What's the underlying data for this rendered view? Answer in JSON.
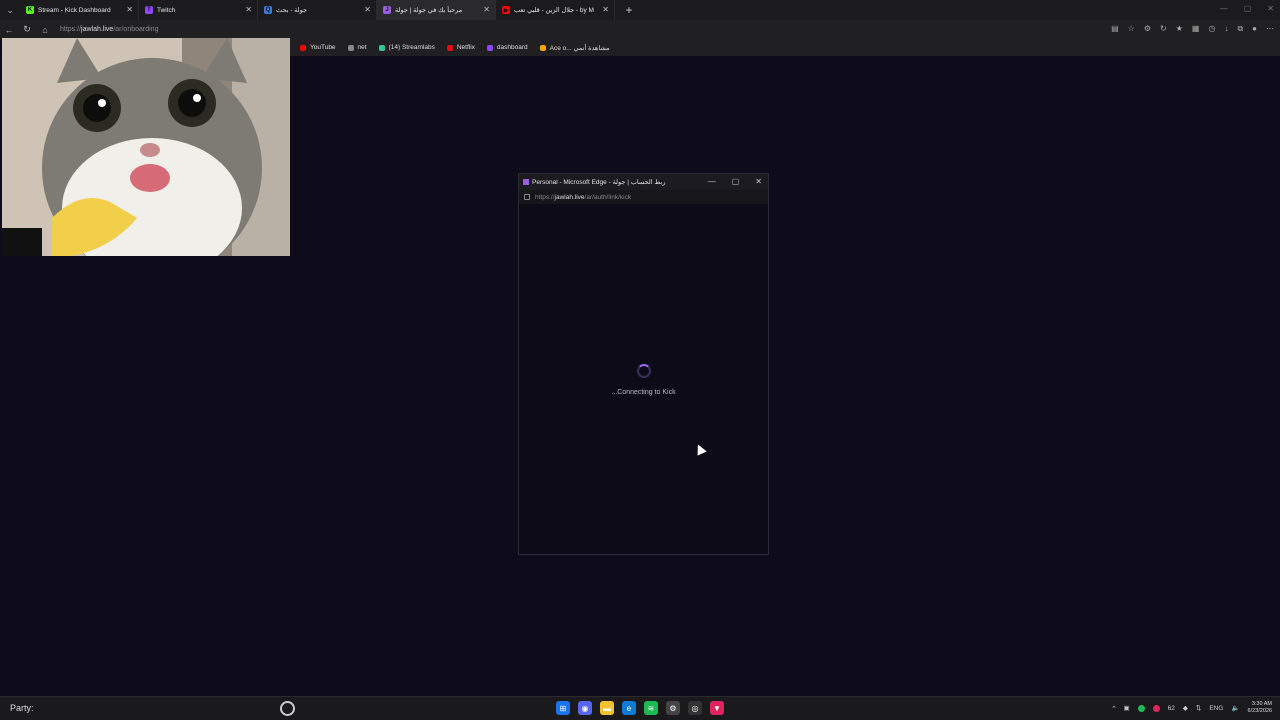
{
  "tabs": [
    {
      "title": "Stream - Kick Dashboard",
      "icon": "kick-icon",
      "color": "#53fc18",
      "glyph": "K"
    },
    {
      "title": "Twitch",
      "icon": "twitch-icon",
      "color": "#9146ff",
      "glyph": "T"
    },
    {
      "title": "جولة - بحث",
      "icon": "search-icon",
      "color": "#3a7bd5",
      "glyph": "Q"
    },
    {
      "title": "مرحباً بك في جولة | جولة",
      "icon": "jawlah-icon",
      "color": "#9b5de5",
      "glyph": "J",
      "active": true
    },
    {
      "title": "جلال الزين - قلبي تعب - by M",
      "icon": "youtube-icon",
      "color": "#ff0000",
      "glyph": "▶"
    }
  ],
  "address_bar": {
    "prefix": "https://",
    "domain": "jawlah.live",
    "path": "/ar/onboarding"
  },
  "bookmarks": [
    {
      "label": "YouTube",
      "color": "#ff0000"
    },
    {
      "label": "net",
      "color": "#888888"
    },
    {
      "label": "(14) Streamlabs",
      "color": "#31c3a2"
    },
    {
      "label": "Netflix",
      "color": "#e50914"
    },
    {
      "label": "dashboard",
      "color": "#9146ff"
    },
    {
      "label": "Ace o... مشاهدة أنمي",
      "color": "#f0a500"
    }
  ],
  "popup": {
    "title": "Personal - Microsoft Edge - ربط الحساب | جولة",
    "url_prefix": "https://",
    "url_domain": "jawlah.live",
    "url_path": "/ar/auth/link/kick",
    "status_text": "...Connecting to Kick"
  },
  "taskbar": {
    "party_label": "Party:",
    "language": "ENG",
    "tray_count": "62",
    "time": "3:30 AM",
    "date": "6/23/2026"
  }
}
